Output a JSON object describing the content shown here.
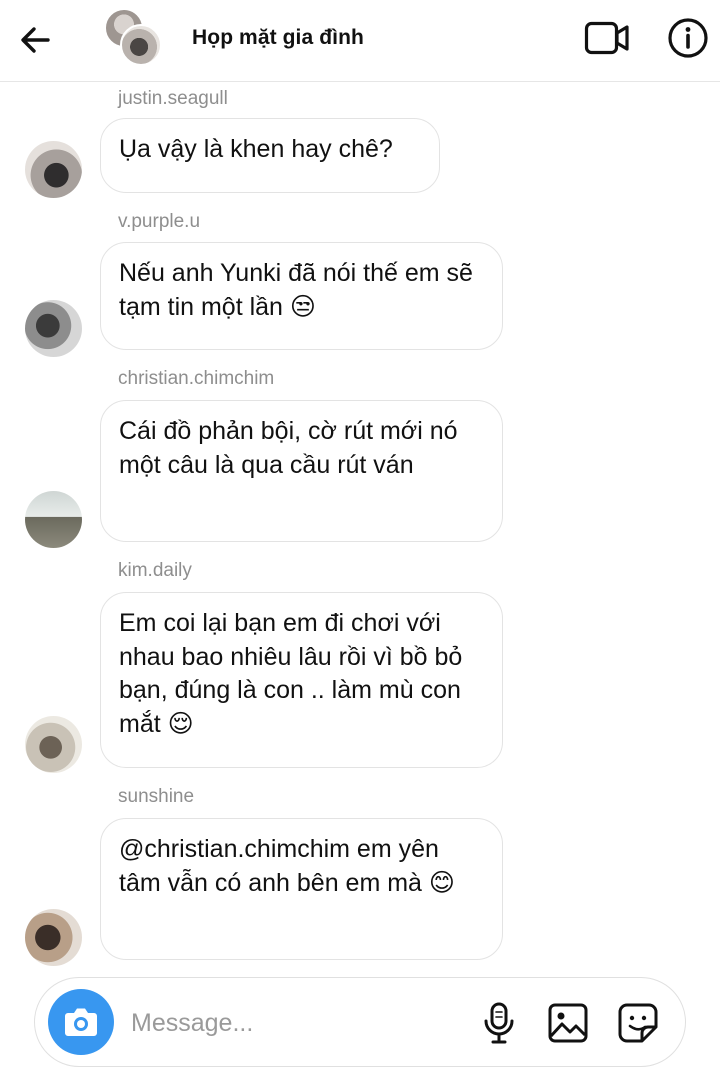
{
  "header": {
    "title": "Họp mặt gia đình",
    "icons": {
      "back": "arrow-left-icon",
      "video": "video-camera-icon",
      "info": "info-circle-icon"
    }
  },
  "messages": [
    {
      "sender": "justin.seagull",
      "text": "Ụa vậy là khen hay chê?"
    },
    {
      "sender": "v.purple.u",
      "text": "Nếu anh Yunki đã nói thế em sẽ tạm tin một lần 😒"
    },
    {
      "sender": "christian.chimchim",
      "text": "Cái đồ phản bội, cờ rút mới nó một câu là qua cầu rút ván"
    },
    {
      "sender": "kim.daily",
      "text": "Em coi lại bạn em đi chơi với nhau bao nhiêu lâu rồi vì bồ bỏ bạn, đúng là con .. làm mù con mắt 😌"
    },
    {
      "sender": "sunshine",
      "text": "@christian.chimchim em yên tâm vẫn có anh bên em mà 😊"
    }
  ],
  "composer": {
    "placeholder": "Message...",
    "accent_color": "#3897f0",
    "icons": {
      "camera": "camera-icon",
      "mic": "microphone-icon",
      "gallery": "image-icon",
      "sticker": "sticker-icon"
    }
  }
}
